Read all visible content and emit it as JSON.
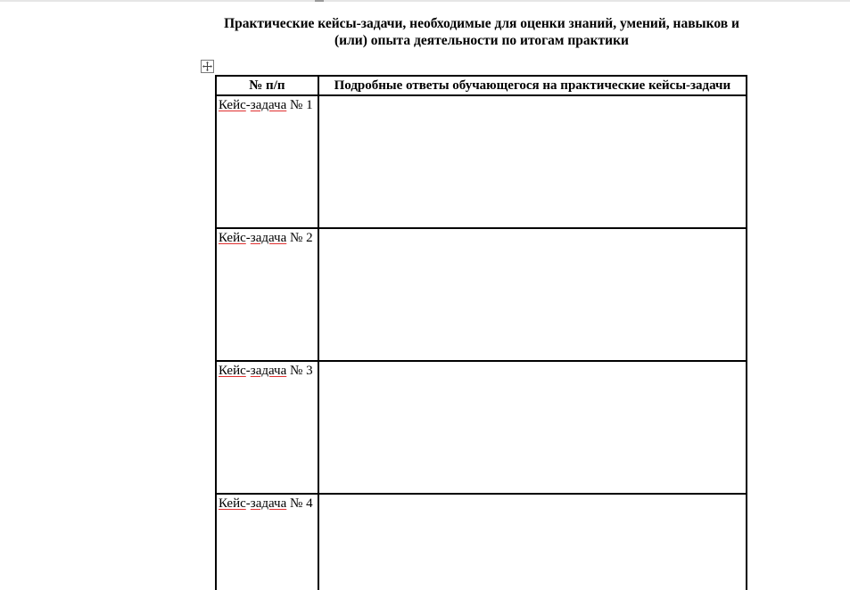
{
  "document": {
    "title_line1": "Практические кейсы-задачи, необходимые для оценки знаний, умений, навыков и",
    "title_line2": "(или) опыта деятельности по итогам практики"
  },
  "table": {
    "headers": {
      "number": "№ п/п",
      "answers": "Подробные ответы обучающегося на практические кейсы-задачи"
    },
    "rows": [
      {
        "word1": "Кейс",
        "dash": "-",
        "word2": "задача",
        "num": " № 1",
        "answer": ""
      },
      {
        "word1": "Кейс",
        "dash": "-",
        "word2": "задача",
        "num": " № 2",
        "answer": ""
      },
      {
        "word1": "Кейс",
        "dash": "-",
        "word2": "задача",
        "num": " № 3",
        "answer": ""
      },
      {
        "word1": "Кейс",
        "dash": "-",
        "word2": "задача",
        "num": " № 4",
        "answer": ""
      }
    ]
  },
  "icons": {
    "table_move_handle": "move-arrows-icon"
  },
  "colors": {
    "spellcheck_underline": "#e03030",
    "border": "#000000"
  }
}
